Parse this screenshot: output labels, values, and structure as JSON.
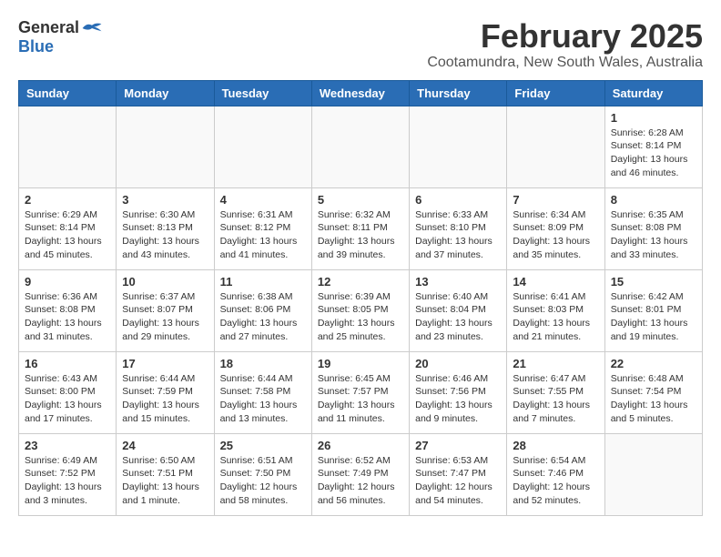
{
  "logo": {
    "general": "General",
    "blue": "Blue"
  },
  "title": {
    "month": "February 2025",
    "location": "Cootamundra, New South Wales, Australia"
  },
  "headers": [
    "Sunday",
    "Monday",
    "Tuesday",
    "Wednesday",
    "Thursday",
    "Friday",
    "Saturday"
  ],
  "weeks": [
    [
      {
        "day": "",
        "info": ""
      },
      {
        "day": "",
        "info": ""
      },
      {
        "day": "",
        "info": ""
      },
      {
        "day": "",
        "info": ""
      },
      {
        "day": "",
        "info": ""
      },
      {
        "day": "",
        "info": ""
      },
      {
        "day": "1",
        "info": "Sunrise: 6:28 AM\nSunset: 8:14 PM\nDaylight: 13 hours and 46 minutes."
      }
    ],
    [
      {
        "day": "2",
        "info": "Sunrise: 6:29 AM\nSunset: 8:14 PM\nDaylight: 13 hours and 45 minutes."
      },
      {
        "day": "3",
        "info": "Sunrise: 6:30 AM\nSunset: 8:13 PM\nDaylight: 13 hours and 43 minutes."
      },
      {
        "day": "4",
        "info": "Sunrise: 6:31 AM\nSunset: 8:12 PM\nDaylight: 13 hours and 41 minutes."
      },
      {
        "day": "5",
        "info": "Sunrise: 6:32 AM\nSunset: 8:11 PM\nDaylight: 13 hours and 39 minutes."
      },
      {
        "day": "6",
        "info": "Sunrise: 6:33 AM\nSunset: 8:10 PM\nDaylight: 13 hours and 37 minutes."
      },
      {
        "day": "7",
        "info": "Sunrise: 6:34 AM\nSunset: 8:09 PM\nDaylight: 13 hours and 35 minutes."
      },
      {
        "day": "8",
        "info": "Sunrise: 6:35 AM\nSunset: 8:08 PM\nDaylight: 13 hours and 33 minutes."
      }
    ],
    [
      {
        "day": "9",
        "info": "Sunrise: 6:36 AM\nSunset: 8:08 PM\nDaylight: 13 hours and 31 minutes."
      },
      {
        "day": "10",
        "info": "Sunrise: 6:37 AM\nSunset: 8:07 PM\nDaylight: 13 hours and 29 minutes."
      },
      {
        "day": "11",
        "info": "Sunrise: 6:38 AM\nSunset: 8:06 PM\nDaylight: 13 hours and 27 minutes."
      },
      {
        "day": "12",
        "info": "Sunrise: 6:39 AM\nSunset: 8:05 PM\nDaylight: 13 hours and 25 minutes."
      },
      {
        "day": "13",
        "info": "Sunrise: 6:40 AM\nSunset: 8:04 PM\nDaylight: 13 hours and 23 minutes."
      },
      {
        "day": "14",
        "info": "Sunrise: 6:41 AM\nSunset: 8:03 PM\nDaylight: 13 hours and 21 minutes."
      },
      {
        "day": "15",
        "info": "Sunrise: 6:42 AM\nSunset: 8:01 PM\nDaylight: 13 hours and 19 minutes."
      }
    ],
    [
      {
        "day": "16",
        "info": "Sunrise: 6:43 AM\nSunset: 8:00 PM\nDaylight: 13 hours and 17 minutes."
      },
      {
        "day": "17",
        "info": "Sunrise: 6:44 AM\nSunset: 7:59 PM\nDaylight: 13 hours and 15 minutes."
      },
      {
        "day": "18",
        "info": "Sunrise: 6:44 AM\nSunset: 7:58 PM\nDaylight: 13 hours and 13 minutes."
      },
      {
        "day": "19",
        "info": "Sunrise: 6:45 AM\nSunset: 7:57 PM\nDaylight: 13 hours and 11 minutes."
      },
      {
        "day": "20",
        "info": "Sunrise: 6:46 AM\nSunset: 7:56 PM\nDaylight: 13 hours and 9 minutes."
      },
      {
        "day": "21",
        "info": "Sunrise: 6:47 AM\nSunset: 7:55 PM\nDaylight: 13 hours and 7 minutes."
      },
      {
        "day": "22",
        "info": "Sunrise: 6:48 AM\nSunset: 7:54 PM\nDaylight: 13 hours and 5 minutes."
      }
    ],
    [
      {
        "day": "23",
        "info": "Sunrise: 6:49 AM\nSunset: 7:52 PM\nDaylight: 13 hours and 3 minutes."
      },
      {
        "day": "24",
        "info": "Sunrise: 6:50 AM\nSunset: 7:51 PM\nDaylight: 13 hours and 1 minute."
      },
      {
        "day": "25",
        "info": "Sunrise: 6:51 AM\nSunset: 7:50 PM\nDaylight: 12 hours and 58 minutes."
      },
      {
        "day": "26",
        "info": "Sunrise: 6:52 AM\nSunset: 7:49 PM\nDaylight: 12 hours and 56 minutes."
      },
      {
        "day": "27",
        "info": "Sunrise: 6:53 AM\nSunset: 7:47 PM\nDaylight: 12 hours and 54 minutes."
      },
      {
        "day": "28",
        "info": "Sunrise: 6:54 AM\nSunset: 7:46 PM\nDaylight: 12 hours and 52 minutes."
      },
      {
        "day": "",
        "info": ""
      }
    ]
  ]
}
